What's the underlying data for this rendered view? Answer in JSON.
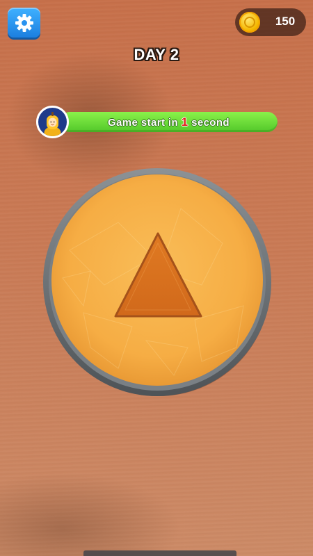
{
  "hud": {
    "settings_icon": "gear-icon",
    "coins": {
      "icon": "coin-icon",
      "amount": "150"
    },
    "day_title": "DAY 2"
  },
  "status": {
    "avatar": "player-avatar",
    "text_before": "Game start in",
    "countdown": "1",
    "text_after": "second",
    "bar_color": "#5fd12e"
  },
  "board": {
    "shape": "triangle",
    "disc_color": "#f7b24c",
    "shape_color": "#d66f1c",
    "rim_color": "#6a6f73"
  }
}
